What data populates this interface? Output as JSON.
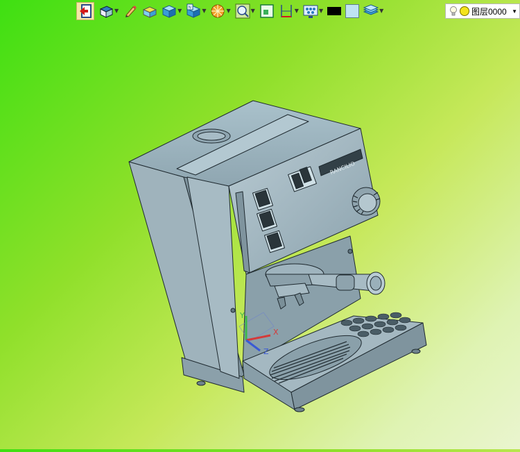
{
  "toolbar": {
    "items": [
      {
        "name": "exit-sketch-button",
        "icon": "exit-icon",
        "has_dropdown": false,
        "active": true
      },
      {
        "name": "view-orientation-button",
        "icon": "view-orientation-icon",
        "has_dropdown": true
      },
      {
        "name": "pencil-button",
        "icon": "pencil-icon",
        "has_dropdown": false
      },
      {
        "name": "shaded-button",
        "icon": "shaded-solid-icon",
        "has_dropdown": false
      },
      {
        "name": "display-mode-button",
        "icon": "cube-icon",
        "has_dropdown": true
      },
      {
        "name": "standard-views-button",
        "icon": "standard-view-icon",
        "has_dropdown": true
      },
      {
        "name": "section-view-button",
        "icon": "section-view-icon",
        "has_dropdown": true
      },
      {
        "name": "zoom-fit-button",
        "icon": "zoom-fit-icon",
        "has_dropdown": true
      },
      {
        "name": "sketch-plane-button",
        "icon": "sketch-plane-icon",
        "has_dropdown": false
      },
      {
        "name": "dimension-button",
        "icon": "dimension-icon",
        "has_dropdown": true
      },
      {
        "name": "render-settings-button",
        "icon": "render-settings-icon",
        "has_dropdown": true
      },
      {
        "name": "line-color-button",
        "icon": "color-swatch-icon",
        "has_dropdown": false
      },
      {
        "name": "face-color-button",
        "icon": "color-swatch-icon",
        "has_dropdown": false
      },
      {
        "name": "layers-button",
        "icon": "layers-icon",
        "has_dropdown": true
      }
    ],
    "line_color": "#000000",
    "face_color": "#bfe3f2"
  },
  "layer_select": {
    "value": "图层0000",
    "icon": "lightbulb-icon",
    "state_icon": "sun-icon"
  },
  "viewport": {
    "background_colors": [
      "#3ee012",
      "#eaf5cf"
    ],
    "model": "espresso-machine",
    "brand_text": "RANCILIO",
    "triad_labels": {
      "x": "X",
      "y": "Y",
      "z": "Z"
    }
  }
}
